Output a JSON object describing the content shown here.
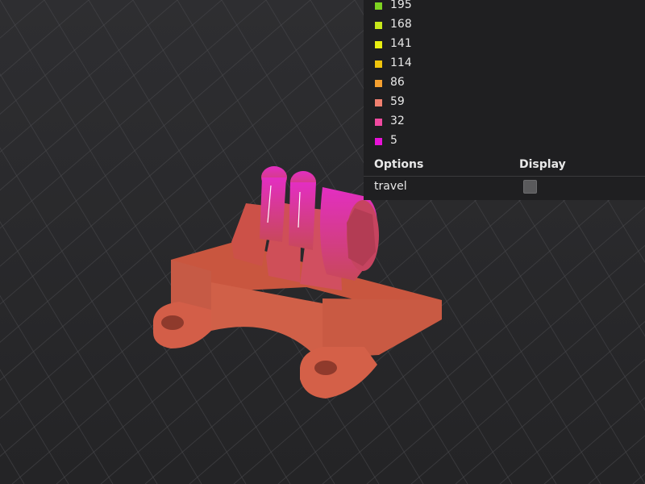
{
  "legend": {
    "items": [
      {
        "value": "195",
        "color": "#7ed321"
      },
      {
        "value": "168",
        "color": "#c8e81a"
      },
      {
        "value": "141",
        "color": "#e8ee10"
      },
      {
        "value": "114",
        "color": "#f0c40c"
      },
      {
        "value": "86",
        "color": "#f5a030"
      },
      {
        "value": "59",
        "color": "#f08070"
      },
      {
        "value": "32",
        "color": "#f04aa0"
      },
      {
        "value": "5",
        "color": "#e812d8"
      }
    ]
  },
  "options": {
    "header_options": "Options",
    "header_display": "Display",
    "rows": [
      {
        "label": "travel",
        "checked": false
      }
    ]
  },
  "model": {
    "main_color": "#d8604c",
    "highlight_color": "#e02ab8"
  }
}
